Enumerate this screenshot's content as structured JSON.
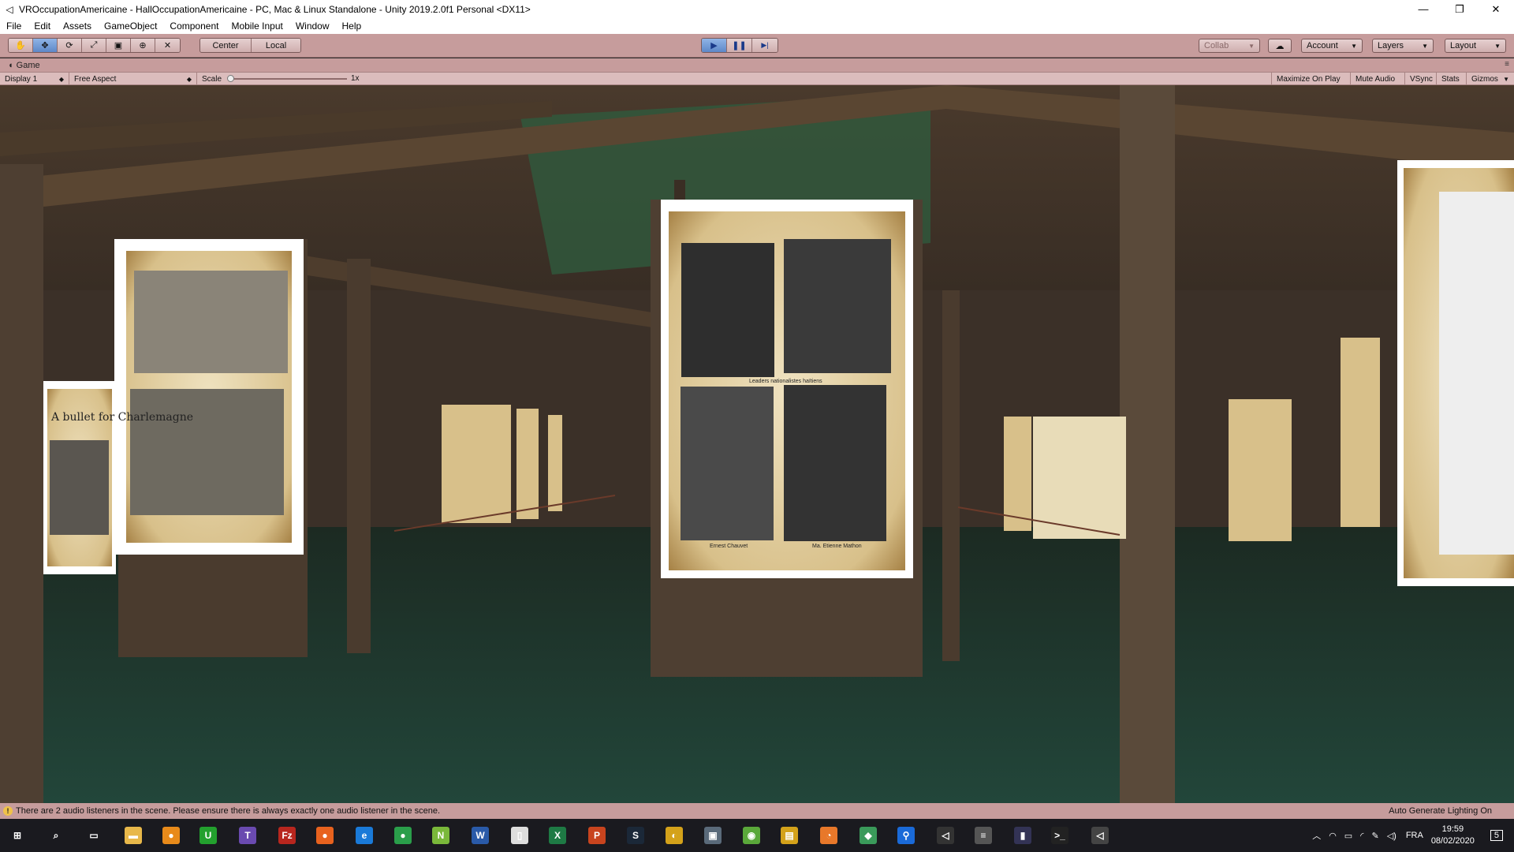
{
  "window": {
    "title": "VROccupationAmericaine - HallOccupationAmericaine - PC, Mac & Linux Standalone - Unity 2019.2.0f1 Personal <DX11>",
    "minimize": "—",
    "maximize": "❐",
    "close": "✕"
  },
  "menu": [
    "File",
    "Edit",
    "Assets",
    "GameObject",
    "Component",
    "Mobile Input",
    "Window",
    "Help"
  ],
  "toolbar": {
    "tools": [
      "✋",
      "✥",
      "⟳",
      "⤢",
      "▣",
      "⊕",
      "✕"
    ],
    "pivot": "Center",
    "space": "Local",
    "play": "▶",
    "pause": "❚❚",
    "step": "▶|",
    "collab": "Collab",
    "account": "Account",
    "layers": "Layers",
    "layout": "Layout"
  },
  "game_tab": {
    "label": "Game",
    "menu": "≡"
  },
  "game_bar": {
    "display": "Display 1",
    "aspect": "Free Aspect",
    "scale_label": "Scale",
    "scale_value": "1x",
    "maximize": "Maximize On Play",
    "mute": "Mute Audio",
    "vsync": "VSync",
    "stats": "Stats",
    "gizmos": "Gizmos"
  },
  "scene": {
    "left_poster_text": "A bullet for Charlemagne",
    "center_captions": [
      "Ernest Chauvet",
      "Ma. Etienne Mathon"
    ],
    "center_subtitle": "Leaders nationalistes haïtiens",
    "colors": {
      "wall": "#3b3028",
      "floor": "#1f3a2f",
      "roof": "#2f5a3d",
      "paper": "#d8c08a",
      "beam": "#5a4632"
    }
  },
  "status": {
    "message": "There are 2 audio listeners in the scene. Please ensure there is always exactly one audio listener in the scene.",
    "right": "Auto Generate Lighting On"
  },
  "taskbar": {
    "apps": [
      {
        "name": "windows-start-icon",
        "glyph": "⊞",
        "color": "#1a1a1f"
      },
      {
        "name": "search-icon",
        "glyph": "⌕",
        "color": "#1a1a1f"
      },
      {
        "name": "task-view-icon",
        "glyph": "▭",
        "color": "#1a1a1f"
      },
      {
        "name": "file-explorer-icon",
        "glyph": "▬",
        "color": "#e8b84a"
      },
      {
        "name": "app-orange-icon",
        "glyph": "●",
        "color": "#e88a1a"
      },
      {
        "name": "upwork-icon",
        "glyph": "U",
        "color": "#23a02e"
      },
      {
        "name": "teams-icon",
        "glyph": "T",
        "color": "#6a4ab0"
      },
      {
        "name": "filezilla-icon",
        "glyph": "Fz",
        "color": "#b8261e"
      },
      {
        "name": "firefox-icon",
        "glyph": "●",
        "color": "#e8621e"
      },
      {
        "name": "edge-icon",
        "glyph": "e",
        "color": "#1a7ad8"
      },
      {
        "name": "chrome-icon",
        "glyph": "●",
        "color": "#2a9e4a"
      },
      {
        "name": "notepadpp-icon",
        "glyph": "N",
        "color": "#7ab83a"
      },
      {
        "name": "word-icon",
        "glyph": "W",
        "color": "#2a5aa8"
      },
      {
        "name": "blank-file-icon",
        "glyph": "▯",
        "color": "#dddddd"
      },
      {
        "name": "excel-icon",
        "glyph": "X",
        "color": "#1e7a44"
      },
      {
        "name": "powerpoint-icon",
        "glyph": "P",
        "color": "#c8441e"
      },
      {
        "name": "steam-icon",
        "glyph": "S",
        "color": "#1b2838"
      },
      {
        "name": "app-yellow-circle-icon",
        "glyph": "◐",
        "color": "#d4a21a"
      },
      {
        "name": "screen-app-icon",
        "glyph": "▣",
        "color": "#5a6a7a"
      },
      {
        "name": "android-app-icon",
        "glyph": "◉",
        "color": "#5aa83a"
      },
      {
        "name": "clapper-icon",
        "glyph": "▤",
        "color": "#d4a21a"
      },
      {
        "name": "blender-icon",
        "glyph": "◔",
        "color": "#e8782a"
      },
      {
        "name": "git-icon",
        "glyph": "◆",
        "color": "#3a9a5a"
      },
      {
        "name": "maps-pin-icon",
        "glyph": "⚲",
        "color": "#1a6ad8"
      },
      {
        "name": "unity-hub-icon",
        "glyph": "◁",
        "color": "#333333"
      },
      {
        "name": "database-icon",
        "glyph": "≡",
        "color": "#555555"
      },
      {
        "name": "bar-app-icon",
        "glyph": "▮",
        "color": "#333355"
      },
      {
        "name": "terminal-icon",
        "glyph": ">_",
        "color": "#222222"
      },
      {
        "name": "unity-icon",
        "glyph": "◁",
        "color": "#444444"
      }
    ],
    "lang": "FRA",
    "time": "19:59",
    "date": "08/02/2020",
    "notifications": "5"
  }
}
